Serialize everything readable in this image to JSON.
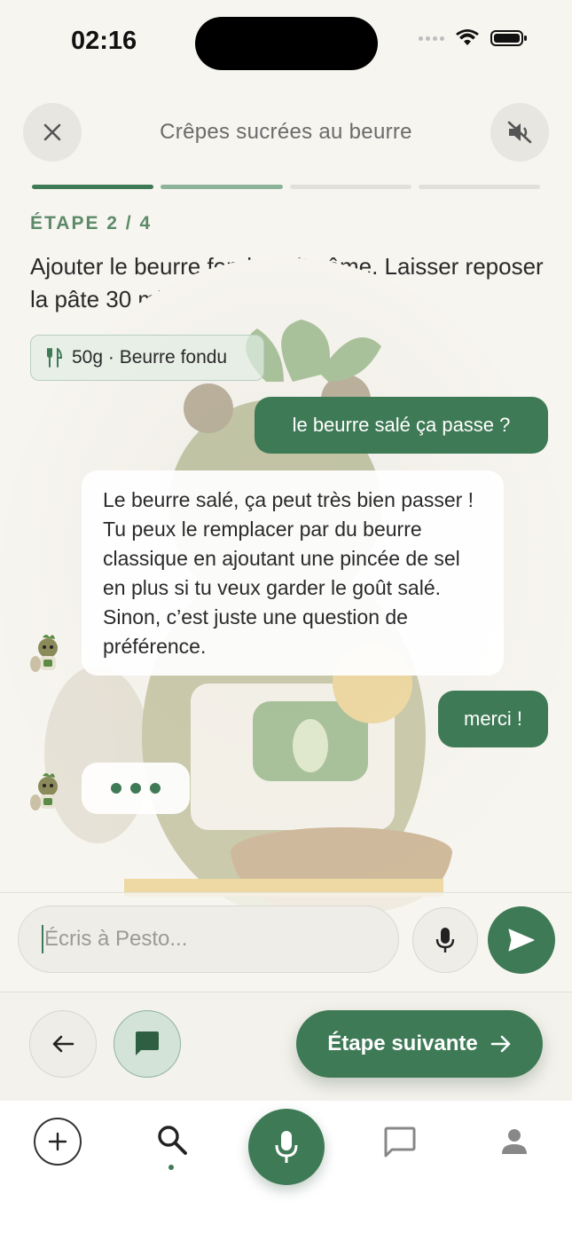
{
  "status_bar": {
    "time": "02:16"
  },
  "header": {
    "title": "Crêpes sucrées au beurre",
    "close_icon": "close-icon",
    "mute_icon": "volume-mute-icon",
    "progress": {
      "total_steps": 4,
      "completed": 1,
      "current": 2
    }
  },
  "step": {
    "label": "ÉTAPE 2 / 4",
    "instruction": "Ajouter le beurre fondu et l'arôme. Laisser reposer la pâte 30 min au frais.",
    "ingredient": "50g · Beurre fondu",
    "ingredient_icon": "fork-knife-icon"
  },
  "chat": {
    "messages": [
      {
        "role": "user",
        "text": "le beurre salé ça passe ?"
      },
      {
        "role": "assistant",
        "text": "Le beurre salé, ça peut très bien passer ! Tu peux le remplacer par du beurre classique en ajoutant une pincée de sel en plus si tu veux garder le goût salé. Sinon, c’est juste une question de préférence."
      },
      {
        "role": "user",
        "text": "merci !"
      },
      {
        "role": "assistant",
        "text": ""
      }
    ],
    "typing_indicator": "•••"
  },
  "composer": {
    "placeholder": "Écris à Pesto..."
  },
  "controls": {
    "next_label": "Étape suivante"
  },
  "tabbar": {
    "items": [
      "add-icon",
      "search-icon",
      "mic-icon",
      "chat-icon",
      "profile-icon"
    ],
    "active": "search-icon"
  },
  "colors": {
    "accent": "#3f7a56",
    "accent_light": "#8cb39a",
    "background": "#f7f5ef"
  }
}
